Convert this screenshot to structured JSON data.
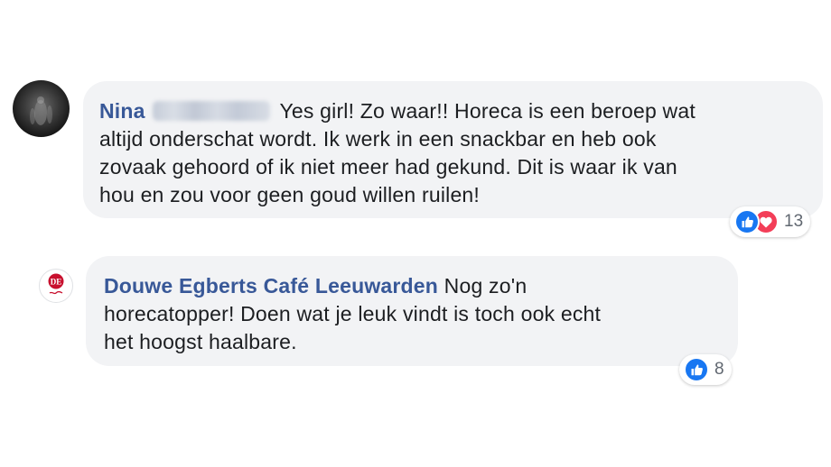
{
  "comments": [
    {
      "author": "Nina",
      "author_surname_redacted": true,
      "text": "Yes girl! Zo waar!! Horeca is een beroep wat altijd onderschat wordt. Ik werk in een snackbar en heb ook zovaak gehoord of ik niet meer had gekund. Dit is waar ik van hou en zou voor geen goud willen ruilen!",
      "text_lines": [
        "Yes girl! Zo waar!! Horeca is een beroep wat",
        "altijd onderschat wordt. Ik werk in een snackbar en heb ook",
        "zovaak gehoord of ik niet meer had gekund. Dit is waar ik van",
        "hou en zou voor geen goud willen ruilen!"
      ],
      "reactions": [
        "like-icon",
        "love-icon"
      ],
      "reaction_count": "13"
    },
    {
      "author": "Douwe Egberts Café Leeuwarden",
      "text": "Nog zo'n horecatopper! Doen wat je leuk vindt is toch ook echt het hoogst haalbare.",
      "text_lines": [
        "Nog zo'n",
        "horecatopper! Doen wat je leuk vindt is toch ook echt",
        "het hoogst haalbare."
      ],
      "reactions": [
        "like-icon"
      ],
      "reaction_count": "8",
      "avatar_logo_text": "DE"
    }
  ],
  "colors": {
    "author": "#385898",
    "bubble_bg": "#f2f3f5",
    "text": "#1c1e21",
    "like": "#1877f2",
    "love": "#f33e58",
    "count": "#606770"
  }
}
